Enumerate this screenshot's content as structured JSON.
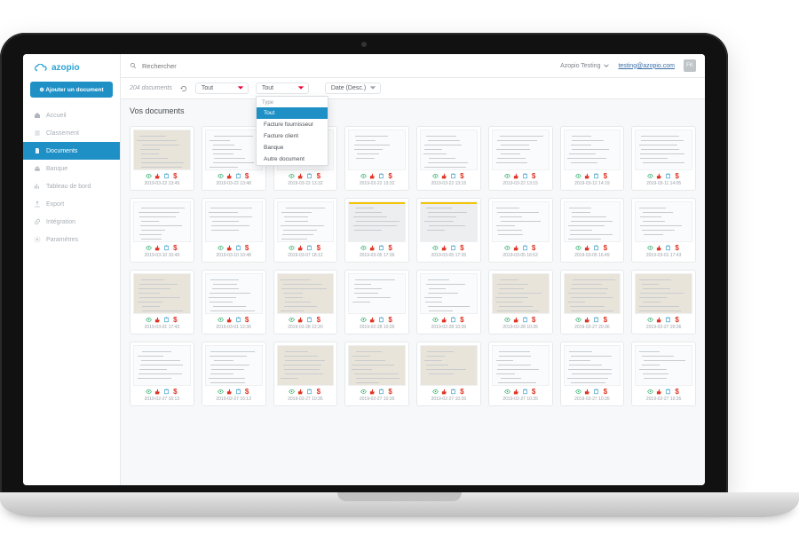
{
  "brand": "azopio",
  "sidebar": {
    "add_label": "⊕ Ajouter un document",
    "items": [
      {
        "icon": "home-icon",
        "label": "Accueil"
      },
      {
        "icon": "list-icon",
        "label": "Classement"
      },
      {
        "icon": "file-icon",
        "label": "Documents"
      },
      {
        "icon": "bank-icon",
        "label": "Banque"
      },
      {
        "icon": "chart-icon",
        "label": "Tableau de bord"
      },
      {
        "icon": "export-icon",
        "label": "Export"
      },
      {
        "icon": "link-icon",
        "label": "Intégration"
      },
      {
        "icon": "gear-icon",
        "label": "Paramètres"
      }
    ],
    "active_index": 2
  },
  "header": {
    "search_placeholder": "Rechercher",
    "org_name": "Azopio Testing",
    "user_email": "testing@azopio.com",
    "user_initials": "FK"
  },
  "filterbar": {
    "doc_count": "204 documents",
    "type_label": "Tout",
    "status_label": "Tout",
    "sort_label": "Date (Desc.)"
  },
  "dropdown": {
    "header": "Type",
    "options": [
      "Tout",
      "Facture fournisseur",
      "Facture client",
      "Banque",
      "Autre document"
    ],
    "selected_index": 0
  },
  "page_title": "Vos documents",
  "documents": [
    {
      "date": "2019-03-22 13:49",
      "kind": "receipt"
    },
    {
      "date": "2019-03-22 13:48",
      "kind": "paper"
    },
    {
      "date": "2019-03-22 13:32",
      "kind": "paper"
    },
    {
      "date": "2019-03-22 13:32",
      "kind": "paper"
    },
    {
      "date": "2019-03-22 13:15",
      "kind": "paper"
    },
    {
      "date": "2019-03-22 13:15",
      "kind": "paper"
    },
    {
      "date": "2019-03-12 14:19",
      "kind": "paper"
    },
    {
      "date": "2019-03-11 14:05",
      "kind": "paper"
    },
    {
      "date": "2019-03-10 10:49",
      "kind": "paper"
    },
    {
      "date": "2019-03-10 10:48",
      "kind": "paper"
    },
    {
      "date": "2019-03-07 18:12",
      "kind": "paper"
    },
    {
      "date": "2019-03-05 17:36",
      "kind": "yellow"
    },
    {
      "date": "2019-03-05 17:35",
      "kind": "yellow"
    },
    {
      "date": "2019-03-05 16:52",
      "kind": "paper"
    },
    {
      "date": "2019-03-05 16:49",
      "kind": "paper"
    },
    {
      "date": "2019-03-01 17:43",
      "kind": "paper"
    },
    {
      "date": "2019-03-01 17:43",
      "kind": "receipt"
    },
    {
      "date": "2019-03-01 12:36",
      "kind": "paper"
    },
    {
      "date": "2019-02-28 12:20",
      "kind": "receipt"
    },
    {
      "date": "2019-02-28 10:35",
      "kind": "paper"
    },
    {
      "date": "2019-02-28 10:35",
      "kind": "paper"
    },
    {
      "date": "2019-02-28 10:35",
      "kind": "receipt"
    },
    {
      "date": "2019-02-27 20:36",
      "kind": "receipt"
    },
    {
      "date": "2019-02-27 20:36",
      "kind": "receipt"
    },
    {
      "date": "2019-02-27 16:13",
      "kind": "paper"
    },
    {
      "date": "2019-02-27 16:13",
      "kind": "paper"
    },
    {
      "date": "2019-02-27 10:35",
      "kind": "receipt"
    },
    {
      "date": "2019-02-27 10:35",
      "kind": "receipt"
    },
    {
      "date": "2019-02-27 10:35",
      "kind": "receipt"
    },
    {
      "date": "2019-02-27 10:35",
      "kind": "paper"
    },
    {
      "date": "2019-02-27 10:35",
      "kind": "paper"
    },
    {
      "date": "2019-02-27 10:35",
      "kind": "paper"
    }
  ]
}
